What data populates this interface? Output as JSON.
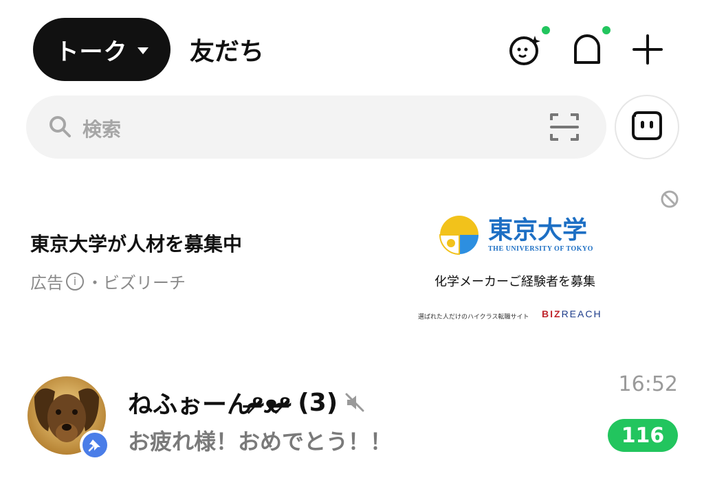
{
  "header": {
    "active_tab": "トーク",
    "other_tab": "友だち"
  },
  "search": {
    "placeholder": "検索"
  },
  "ad": {
    "title": "東京大学が人材を募集中",
    "label": "広告",
    "info_glyph": "i",
    "sponsor": "・ビズリーチ",
    "banner": {
      "logo_jp": "東京大学",
      "logo_en": "THE UNIVERSITY OF TOKYO",
      "tagline": "化学メーカーご経験者を募集",
      "footnote": "選ばれた人だけのハイクラス転職サイト",
      "brand_biz": "BIZ",
      "brand_reach": "REACH"
    }
  },
  "chat": {
    "name": "ねふぉーんᵒ̴̶̷ᴥᵒ̴̶̷",
    "member_count": "(3)",
    "preview": "お疲れ様！おめでとう！！",
    "time": "16:52",
    "unread": "116"
  },
  "colors": {
    "accent_green": "#22c55e",
    "pin_blue": "#4a7de8",
    "univ_blue": "#1d6fc4"
  },
  "icons": [
    "chevron-down-icon",
    "face-sparkle-icon",
    "notification-icon",
    "plus-icon",
    "search-icon",
    "scan-icon",
    "bot-icon",
    "ad-close-icon",
    "pin-icon",
    "mute-icon"
  ]
}
